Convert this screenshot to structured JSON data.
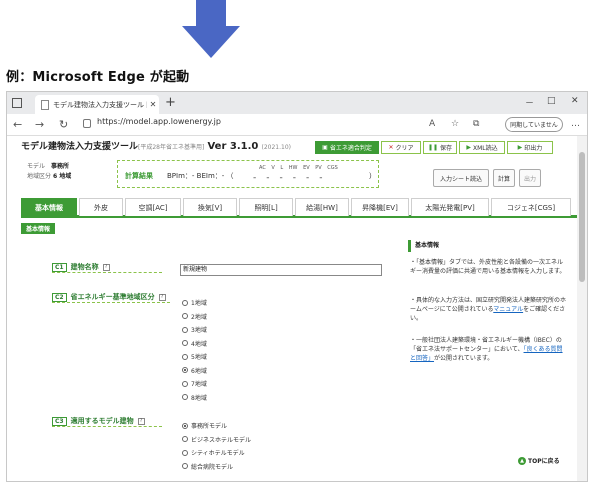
{
  "caption": "例：Microsoft Edge が起動",
  "browser": {
    "tab_title": "モデル建物法入力支援ツール [平成",
    "url": "https://model.app.lowenergy.jp",
    "sync_label": "同期していません",
    "window": {
      "min": "－",
      "max": "□",
      "close": "✕"
    }
  },
  "app": {
    "title": "モデル建物法入力支援ツール",
    "subtitle": "[平成28年省エネ基準用]",
    "version": "Ver 3.1.0",
    "version_date": "(2021.10)",
    "buttons": {
      "model_calc": "省エネ適合判定",
      "clear": "クリア",
      "save": "保存",
      "xml_load": "XML読込",
      "print": "印出力"
    },
    "model_label": "モデル",
    "model_value": "事務所",
    "region_label": "地域区分",
    "region_value": "6 地域",
    "calc_label": "計算結果",
    "calc_values": "BPIm：-  BEIm：-  （",
    "calc_columns": "AC  V  L  HW  EV  PV  CGS",
    "calc_dashes": "------",
    "calc_close": "）",
    "side_buttons": {
      "input_sheet": "入力シート読込",
      "calculate": "計算",
      "output": "出力"
    }
  },
  "tabs": [
    {
      "label": "基本情報",
      "active": true
    },
    {
      "label": "外皮",
      "active": false
    },
    {
      "label": "空調[AC]",
      "active": false
    },
    {
      "label": "換気[V]",
      "active": false
    },
    {
      "label": "照明[L]",
      "active": false
    },
    {
      "label": "給湯[HW]",
      "active": false
    },
    {
      "label": "昇降機[EV]",
      "active": false
    },
    {
      "label": "太陽光発電[PV]",
      "active": false
    },
    {
      "label": "コジェネ[CGS]",
      "active": false
    }
  ],
  "section_tag": "基本情報",
  "form": {
    "c1": {
      "code": "C1",
      "label": "建物名称",
      "value": "新規建物"
    },
    "c2": {
      "code": "C2",
      "label": "省エネルギー基準地域区分",
      "options": [
        "1地域",
        "2地域",
        "3地域",
        "4地域",
        "5地域",
        "6地域",
        "7地域",
        "8地域"
      ],
      "selected": 5
    },
    "c3": {
      "code": "C3",
      "label": "適用するモデル建物",
      "options": [
        "事務所モデル",
        "ビジネスホテルモデル",
        "シティホテルモデル",
        "総合病院モデル"
      ],
      "selected": 0
    }
  },
  "info": {
    "head": "基本情報",
    "p1": "・「基本情報」タブでは、外皮性能と各設備の一次エネルギー消費量の評価に共通で用いる基本情報を入力します。",
    "p2a": "・具体的な入力方法は、国立研究開発法人建築研究所のホームページにて公開されている",
    "p2link": "マニュアル",
    "p2b": "をご確認ください。",
    "p3a": "・一般社団法人建築環境・省エネルギー機構（IBEC）の「省エネ法サポートセンター」において、",
    "p3link": "「良くある質問と回答」",
    "p3b": "が公開されています。",
    "top_button": "TOPに戻る"
  }
}
